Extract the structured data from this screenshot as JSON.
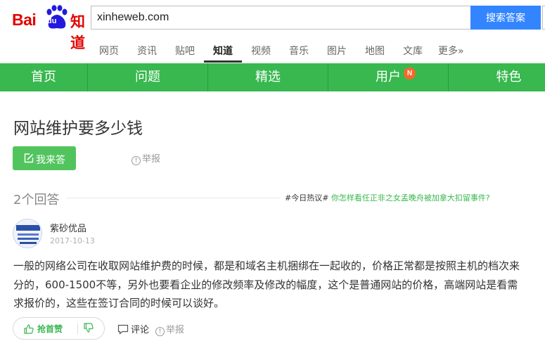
{
  "logo": {
    "bai": "Bai",
    "du": "du",
    "zhidao": "知道"
  },
  "search": {
    "value": "xinheweb.com",
    "button_label": "搜索答案"
  },
  "channels": [
    {
      "label": "网页"
    },
    {
      "label": "资讯"
    },
    {
      "label": "贴吧"
    },
    {
      "label": "知道"
    },
    {
      "label": "视频"
    },
    {
      "label": "音乐"
    },
    {
      "label": "图片"
    },
    {
      "label": "地图"
    },
    {
      "label": "文库"
    },
    {
      "label": "更多»"
    }
  ],
  "green_nav": [
    {
      "label": "首页"
    },
    {
      "label": "问题"
    },
    {
      "label": "精选"
    },
    {
      "label": "用户"
    },
    {
      "label": "特色"
    }
  ],
  "user_badge": "N",
  "question": {
    "title": "网站维护要多少钱",
    "answer_button": "我来答",
    "report": "举报"
  },
  "answers_header": {
    "count": "2个回答",
    "hot_tag": "#今日热议#",
    "hot_link": "你怎样看任正非之女孟晚舟被加拿大扣留事件?"
  },
  "answer": {
    "username": "紫砂优品",
    "date": "2017-10-13",
    "text": "一般的网络公司在收取网站维护费的时候，都是和域名主机捆绑在一起收的，价格正常都是按照主机的档次来分的，600-1500不等，另外也要看企业的修改频率及修改的幅度，这个是普通网站的价格，高端网站是看需求报价的，这些在签订合同的时候可以谈好。",
    "upvote": "抢首赞",
    "comment": "评论",
    "report": "举报"
  },
  "colors": {
    "brand_green": "#38b84f",
    "search_blue": "#3385ff",
    "logo_red": "#e10601",
    "badge_orange": "#f7682b"
  }
}
